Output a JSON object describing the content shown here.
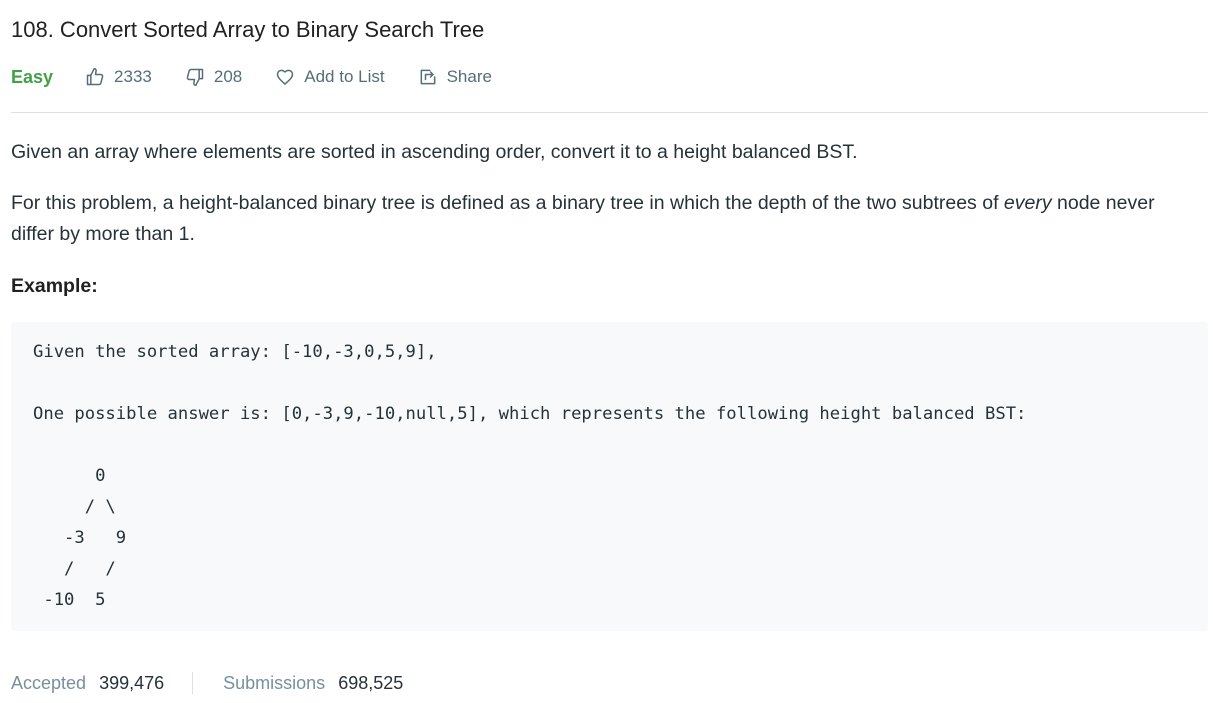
{
  "problem": {
    "title": "108. Convert Sorted Array to Binary Search Tree",
    "difficulty": "Easy",
    "likes": "2333",
    "dislikes": "208",
    "add_to_list_label": "Add to List",
    "share_label": "Share"
  },
  "description": {
    "paragraph1": "Given an array where elements are sorted in ascending order, convert it to a height balanced BST.",
    "paragraph2_before": "For this problem, a height-balanced binary tree is defined as a binary tree in which the depth of the two subtrees of ",
    "paragraph2_emphasis": "every",
    "paragraph2_after": " node never differ by more than 1.",
    "example_heading": "Example:",
    "example_code": "Given the sorted array: [-10,-3,0,5,9],\n\nOne possible answer is: [0,-3,9,-10,null,5], which represents the following height balanced BST:\n\n      0\n     / \\\n   -3   9\n   /   /\n -10  5"
  },
  "stats": {
    "accepted_label": "Accepted",
    "accepted_value": "399,476",
    "submissions_label": "Submissions",
    "submissions_value": "698,525"
  },
  "icons": {
    "like": "thumbs-up-icon",
    "dislike": "thumbs-down-icon",
    "add_to_list": "heart-icon",
    "share": "share-icon"
  },
  "colors": {
    "difficulty_easy": "#43a047",
    "meta_text": "#546e7a",
    "code_background": "#f7f9fa"
  }
}
